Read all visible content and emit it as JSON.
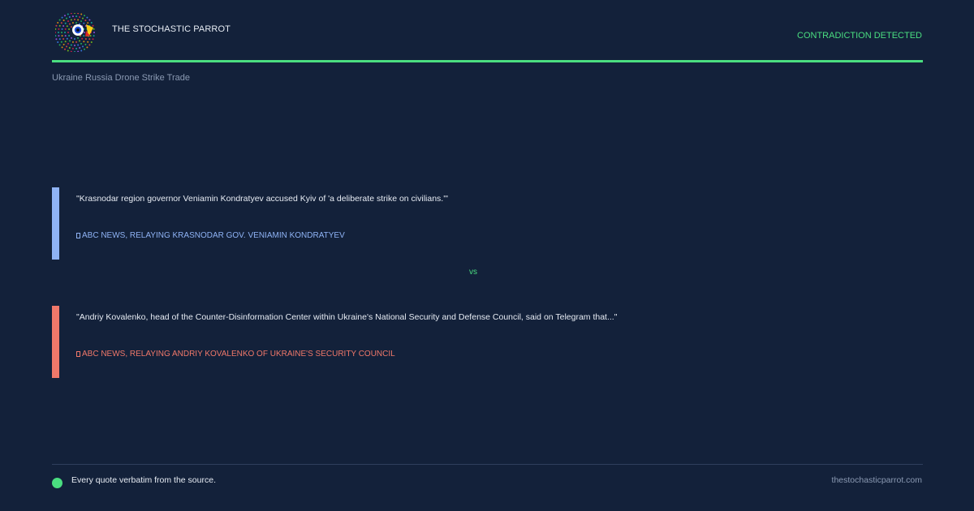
{
  "header": {
    "brand": "THE STOCHASTIC PARROT",
    "status": "CONTRADICTION DETECTED",
    "logo_icon": "parrot-logo-icon"
  },
  "topic": "Ukraine Russia Drone Strike Trade",
  "quotes": [
    {
      "text": "\"Krasnodar region governor Veniamin Kondratyev accused Kyiv of 'a deliberate strike on civilians.'\"",
      "attribution": "ABC NEWS, RELAYING KRASNODAR GOV. VENIAMIN KONDRATYEV",
      "color": "#8fb3f5"
    },
    {
      "text": "\"Andriy Kovalenko, head of the Counter-Disinformation Center within Ukraine's National Security and Defense Council, said on Telegram that...\"",
      "attribution": "ABC NEWS, RELAYING ANDRIY KOVALENKO OF UKRAINE'S SECURITY COUNCIL",
      "color": "#f0786a"
    }
  ],
  "separator": "vs",
  "footer": {
    "note": "Every quote verbatim from the source.",
    "site": "thestochasticparrot.com"
  },
  "colors": {
    "background": "#13213a",
    "accent": "#4ade80",
    "quote_a": "#8fb3f5",
    "quote_b": "#f0786a"
  }
}
